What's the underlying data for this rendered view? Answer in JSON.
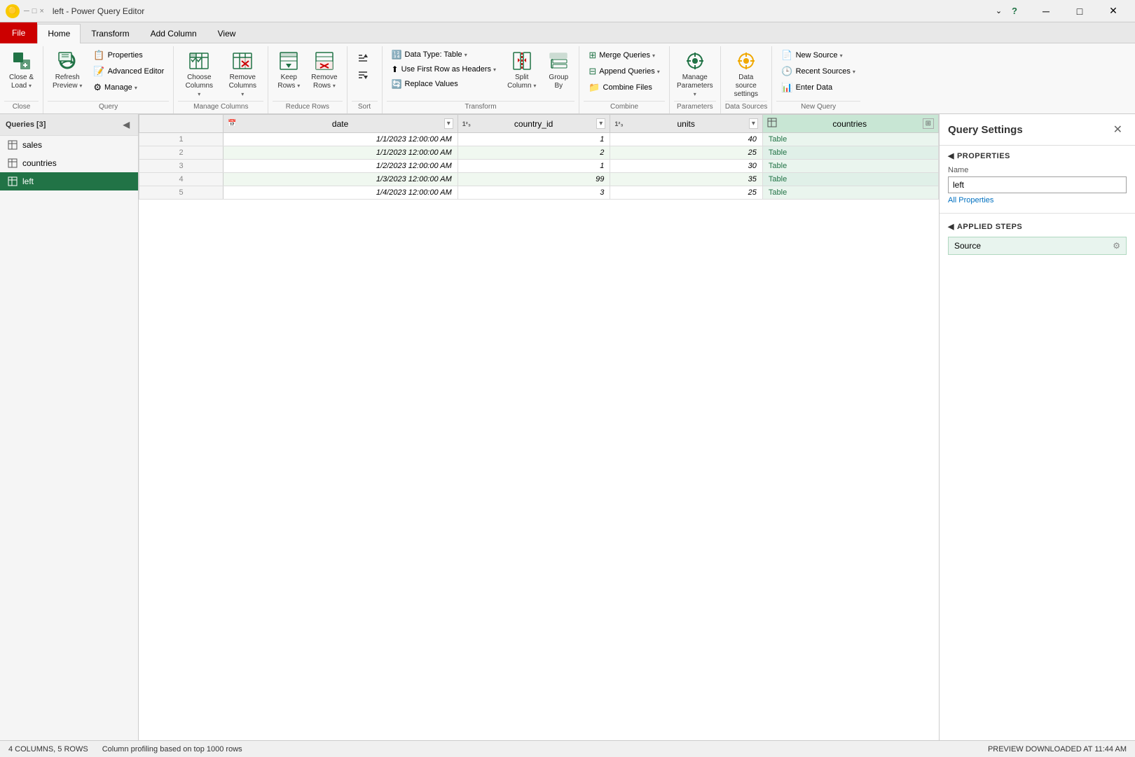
{
  "titleBar": {
    "icon": "🟡",
    "title": "left - Power Query Editor",
    "minimizeBtn": "─",
    "maximizeBtn": "□",
    "closeBtn": "✕"
  },
  "ribbonTabs": [
    {
      "id": "file",
      "label": "File",
      "active": false,
      "isFile": true
    },
    {
      "id": "home",
      "label": "Home",
      "active": true
    },
    {
      "id": "transform",
      "label": "Transform"
    },
    {
      "id": "addColumn",
      "label": "Add Column"
    },
    {
      "id": "view",
      "label": "View"
    }
  ],
  "ribbon": {
    "groups": [
      {
        "id": "close",
        "label": "Close",
        "buttons": [
          {
            "id": "closeLoad",
            "icon": "📤",
            "label": "Close &\nLoad",
            "hasArrow": true
          }
        ]
      },
      {
        "id": "query",
        "label": "Query",
        "buttons": [
          {
            "id": "refresh",
            "icon": "🔄",
            "label": "Refresh\nPreview",
            "hasArrow": true
          },
          {
            "id": "properties",
            "icon": "📋",
            "label": "Properties",
            "small": true
          },
          {
            "id": "advancedEditor",
            "icon": "📝",
            "label": "Advanced Editor",
            "small": true
          },
          {
            "id": "manage",
            "icon": "⚙",
            "label": "Manage ▾",
            "small": true
          }
        ]
      },
      {
        "id": "manageColumns",
        "label": "Manage Columns",
        "buttons": [
          {
            "id": "chooseColumns",
            "icon": "☰",
            "label": "Choose\nColumns",
            "hasArrow": true
          },
          {
            "id": "removeColumns",
            "icon": "✖",
            "label": "Remove\nColumns",
            "hasArrow": true
          }
        ]
      },
      {
        "id": "reduceRows",
        "label": "Reduce Rows",
        "buttons": [
          {
            "id": "keepRows",
            "icon": "⬇",
            "label": "Keep\nRows",
            "hasArrow": true
          },
          {
            "id": "removeRows",
            "icon": "✖",
            "label": "Remove\nRows",
            "hasArrow": true
          }
        ]
      },
      {
        "id": "sort",
        "label": "Sort",
        "buttons": [
          {
            "id": "sortAsc",
            "icon": "↑",
            "label": "",
            "small": true
          },
          {
            "id": "sortDesc",
            "icon": "↓",
            "label": "",
            "small": true
          }
        ]
      },
      {
        "id": "transform",
        "label": "Transform",
        "buttons": [
          {
            "id": "dataType",
            "icon": "🔢",
            "label": "Data Type: Table ▾",
            "small": true
          },
          {
            "id": "useFirstRow",
            "icon": "⬆",
            "label": "Use First Row as Headers ▾",
            "small": true
          },
          {
            "id": "replaceValues",
            "icon": "🔄",
            "label": "Replace Values",
            "small": true
          },
          {
            "id": "splitColumn",
            "icon": "⚡",
            "label": "Split\nColumn",
            "hasArrow": true
          },
          {
            "id": "groupBy",
            "icon": "🗂",
            "label": "Group\nBy"
          }
        ]
      },
      {
        "id": "combine",
        "label": "Combine",
        "buttons": [
          {
            "id": "mergeQueries",
            "icon": "⊕",
            "label": "Merge Queries ▾",
            "small": true
          },
          {
            "id": "appendQueries",
            "icon": "⊕",
            "label": "Append Queries ▾",
            "small": true
          },
          {
            "id": "combineFiles",
            "icon": "📁",
            "label": "Combine Files",
            "small": true
          }
        ]
      },
      {
        "id": "parameters",
        "label": "Parameters",
        "buttons": [
          {
            "id": "manageParameters",
            "icon": "⚙",
            "label": "Manage\nParameters",
            "hasArrow": true
          }
        ]
      },
      {
        "id": "dataSources",
        "label": "Data Sources",
        "buttons": [
          {
            "id": "dataSourceSettings",
            "icon": "⚙",
            "label": "Data source\nsettings"
          }
        ]
      },
      {
        "id": "newQuery",
        "label": "New Query",
        "buttons": [
          {
            "id": "newSource",
            "icon": "📄",
            "label": "New Source ▾",
            "small": true
          },
          {
            "id": "recentSources",
            "icon": "🕒",
            "label": "Recent Sources ▾",
            "small": true
          },
          {
            "id": "enterData",
            "icon": "📊",
            "label": "Enter Data",
            "small": true
          }
        ]
      }
    ]
  },
  "queriesPanel": {
    "title": "Queries [3]",
    "queries": [
      {
        "id": "sales",
        "label": "sales",
        "active": false
      },
      {
        "id": "countries",
        "label": "countries",
        "active": false
      },
      {
        "id": "left",
        "label": "left",
        "active": true
      }
    ]
  },
  "dataTable": {
    "columns": [
      {
        "id": "date",
        "name": "date",
        "type": "date",
        "typeLabel": "📅"
      },
      {
        "id": "country_id",
        "name": "country_id",
        "type": "number",
        "typeLabel": "1²₃"
      },
      {
        "id": "units",
        "name": "units",
        "type": "number",
        "typeLabel": "1²₃"
      },
      {
        "id": "countries",
        "name": "countries",
        "type": "table",
        "typeLabel": "▦"
      }
    ],
    "rows": [
      {
        "rowNum": 1,
        "date": "1/1/2023 12:00:00 AM",
        "country_id": "1",
        "units": "40",
        "countries": "Table"
      },
      {
        "rowNum": 2,
        "date": "1/1/2023 12:00:00 AM",
        "country_id": "2",
        "units": "25",
        "countries": "Table"
      },
      {
        "rowNum": 3,
        "date": "1/2/2023 12:00:00 AM",
        "country_id": "1",
        "units": "30",
        "countries": "Table"
      },
      {
        "rowNum": 4,
        "date": "1/3/2023 12:00:00 AM",
        "country_id": "99",
        "units": "35",
        "countries": "Table"
      },
      {
        "rowNum": 5,
        "date": "1/4/2023 12:00:00 AM",
        "country_id": "3",
        "units": "25",
        "countries": "Table"
      }
    ]
  },
  "querySettings": {
    "title": "Query Settings",
    "propertiesLabel": "◀ PROPERTIES",
    "nameLabel": "Name",
    "nameValue": "left",
    "allPropertiesLink": "All Properties",
    "appliedStepsLabel": "◀ APPLIED STEPS",
    "steps": [
      {
        "id": "source",
        "label": "Source"
      }
    ]
  },
  "statusBar": {
    "columns": "4 COLUMNS, 5 ROWS",
    "profiling": "Column profiling based on top 1000 rows",
    "preview": "PREVIEW DOWNLOADED AT 11:44 AM"
  }
}
